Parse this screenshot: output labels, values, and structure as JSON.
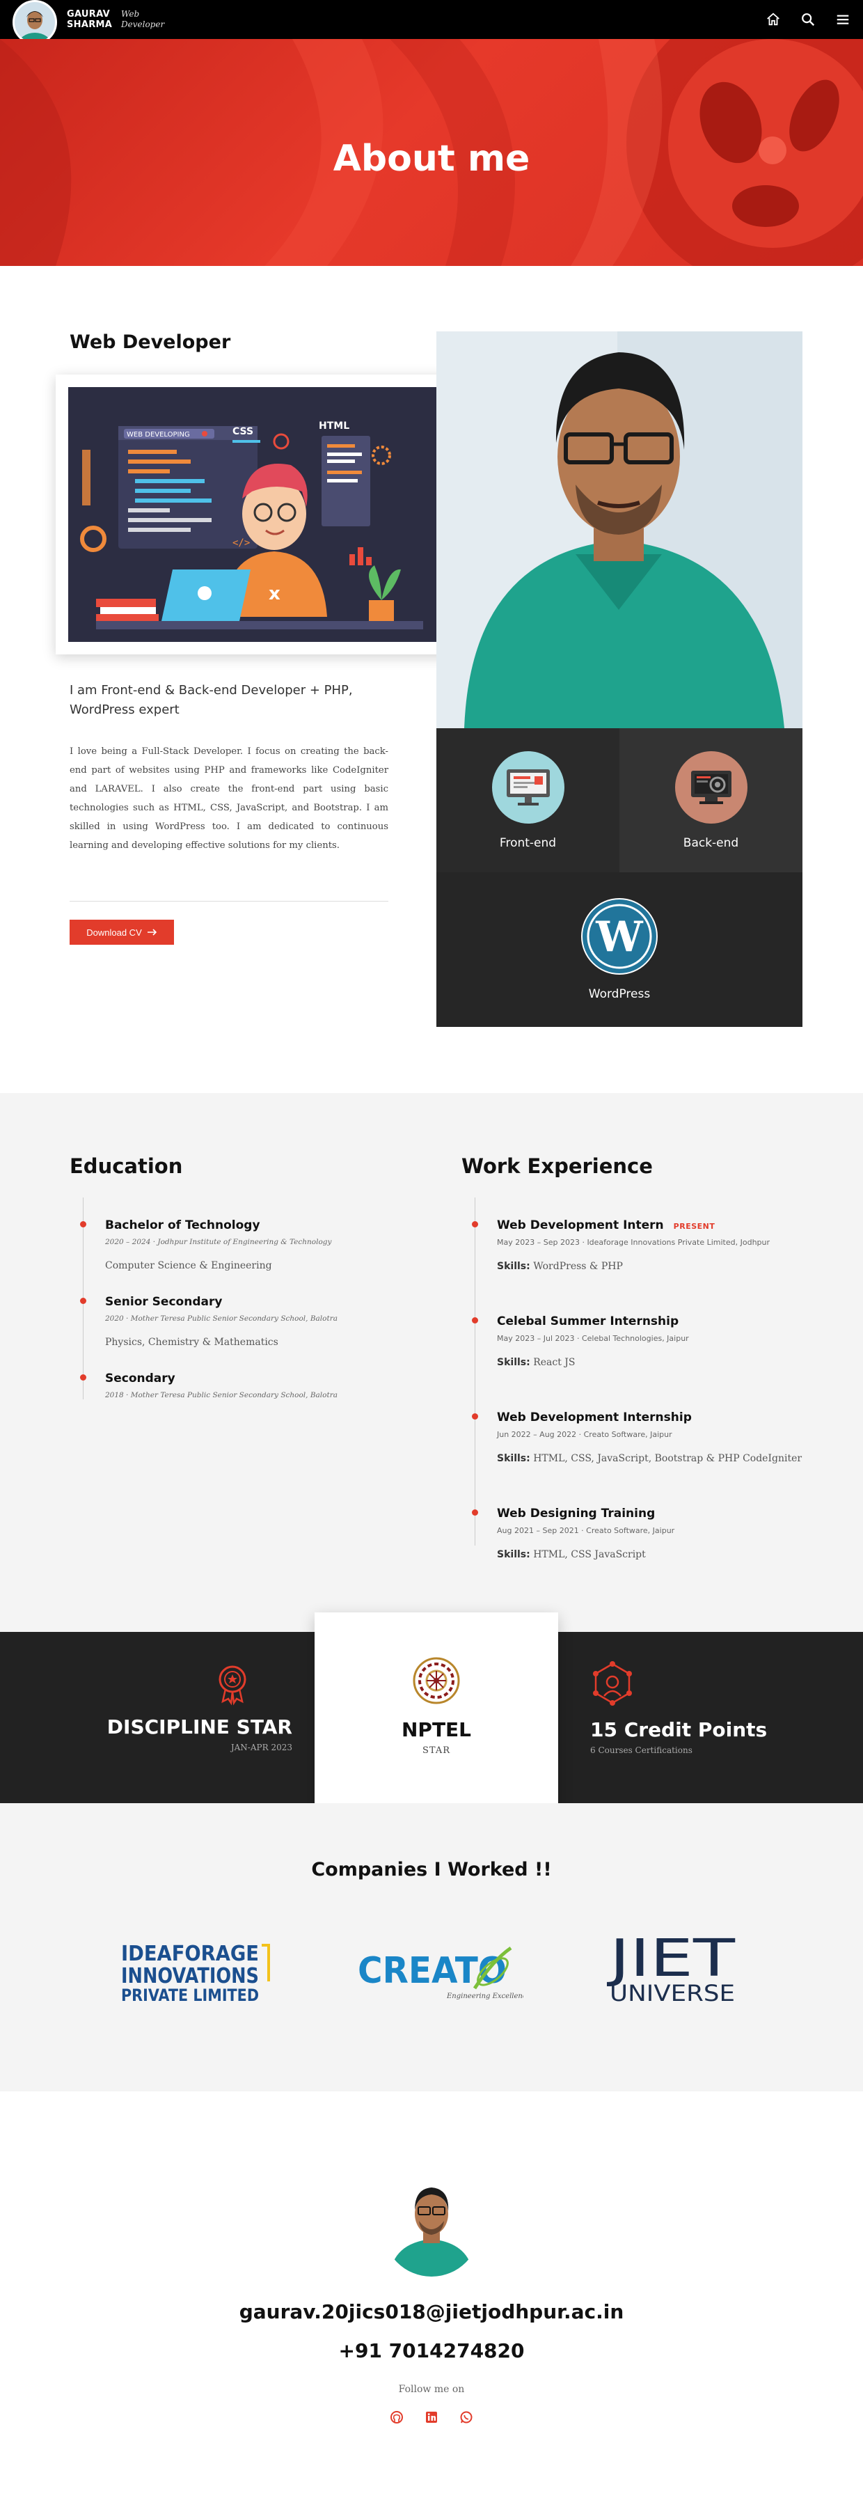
{
  "nav": {
    "name_line1": "GAURAV",
    "name_line2": "SHARMA",
    "role_line1": "Web",
    "role_line2": "Developer",
    "icons": [
      "home-icon",
      "search-icon",
      "menu-icon"
    ]
  },
  "hero": {
    "title": "About me"
  },
  "about": {
    "title": "Web Developer",
    "illustration_labels": {
      "tag1": "WEB DEVELOPING",
      "tag2": "CSS",
      "tag3": "HTML"
    },
    "lead": "I am Front-end & Back-end Developer + PHP, WordPress expert",
    "body": "I love being a Full-Stack Developer. I focus on creating the back-end part of websites using PHP and frameworks like CodeIgniter and LARAVEL. I also create the front-end part using basic technologies such as HTML, CSS, JavaScript, and Bootstrap. I am skilled in using WordPress too. I am dedicated to continuous learning and developing effective solutions for my clients.",
    "download_label": "Download CV",
    "skills": [
      {
        "label": "Front-end",
        "icon": "monitor-icon"
      },
      {
        "label": "Back-end",
        "icon": "server-icon"
      },
      {
        "label": "WordPress",
        "icon": "wordpress-icon"
      }
    ]
  },
  "education": {
    "title": "Education",
    "items": [
      {
        "title": "Bachelor of Technology",
        "meta": "2020 – 2024 · Jodhpur Institute of Engineering & Technology",
        "desc": "Computer Science & Engineering"
      },
      {
        "title": "Senior Secondary",
        "meta": "2020 · Mother Teresa Public Senior Secondary School, Balotra",
        "desc": "Physics, Chemistry & Mathematics"
      },
      {
        "title": "Secondary",
        "meta": "2018 · Mother Teresa Public Senior Secondary School, Balotra",
        "desc": ""
      }
    ]
  },
  "work": {
    "title": "Work Experience",
    "present_label": "PRESENT",
    "skills_label": "Skills:",
    "items": [
      {
        "title": "Web Development Intern",
        "meta": "May 2023 – Sep 2023 · Ideaforage Innovations Private Limited, Jodhpur",
        "skills": "WordPress & PHP"
      },
      {
        "title": "Celebal Summer Internship",
        "meta": "May 2023 – Jul 2023 · Celebal Technologies, Jaipur",
        "skills": "React JS"
      },
      {
        "title": "Web Development Internship",
        "meta": "Jun 2022 – Aug 2022 · Creato Software, Jaipur",
        "skills": "HTML, CSS, JavaScript, Bootstrap & PHP CodeIgniter"
      },
      {
        "title": "Web Designing Training",
        "meta": "Aug 2021 – Sep 2021 · Creato Software, Jaipur",
        "skills": "HTML, CSS JavaScript"
      }
    ]
  },
  "stats": [
    {
      "big": "DISCIPLINE STAR",
      "small": "JAN-APR 2023",
      "icon": "award-icon"
    },
    {
      "big": "NPTEL",
      "small": "STAR",
      "icon": "nptel-logo-icon"
    },
    {
      "big": "15 Credit Points",
      "small": "6 Courses Certifications",
      "icon": "network-icon"
    }
  ],
  "companies": {
    "title": "Companies I Worked !!",
    "logos": [
      {
        "line1": "IDEAFORAGE",
        "line2": "INNOVATIONS",
        "line3": "PRIVATE LIMITED"
      },
      {
        "name": "CREATO",
        "tagline": "Engineering Excellence"
      },
      {
        "line1": "JIET",
        "line2": "UNIVERSE"
      }
    ]
  },
  "contact": {
    "email": "gaurav.20jics018@jietjodhpur.ac.in",
    "phone": "+91 7014274820",
    "follow_label": "Follow me on",
    "socials": [
      "github-icon",
      "linkedin-icon",
      "whatsapp-icon"
    ]
  },
  "colors": {
    "accent": "#e23c2b",
    "dark": "#222222",
    "light_bg": "#f4f4f4"
  }
}
